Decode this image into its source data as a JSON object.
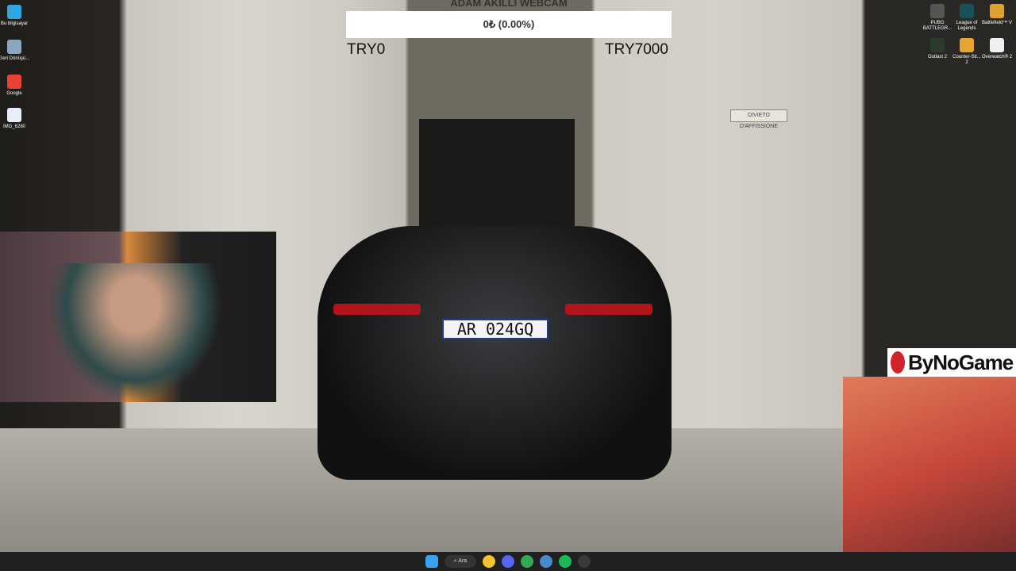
{
  "overlay": {
    "title": "ADAM AKILLI WEBCAM",
    "progress_text": "0₺ (0.00%)",
    "progress_percent": 0,
    "min_label": "TRY0",
    "max_label": "TRY7000"
  },
  "scene": {
    "plate": "AR 024GQ",
    "sign": "DIVIETO D'AFFISSIONE"
  },
  "desktop_left": [
    {
      "label": "Bu bilgisayar",
      "icon": "computer-icon",
      "color": "#2fa6e0"
    },
    {
      "label": "Geri Dönüşü...",
      "icon": "recycle-bin-icon",
      "color": "#8aa6c0"
    },
    {
      "label": "Google",
      "icon": "chrome-icon",
      "color": "#e94235"
    },
    {
      "label": "IMG_6280",
      "icon": "image-file-icon",
      "color": "#e8eef6"
    }
  ],
  "desktop_right": [
    {
      "label": "PUBG BATTLEGR...",
      "icon": "pubg-icon",
      "color": "#555"
    },
    {
      "label": "League of Legends",
      "icon": "lol-icon",
      "color": "#1a5058"
    },
    {
      "label": "Battlefield™ V",
      "icon": "battlefield-icon",
      "color": "#e0a030"
    },
    {
      "label": "Outlast 2",
      "icon": "outlast-icon",
      "color": "#2b3a2a"
    },
    {
      "label": "Counter-Str... 2",
      "icon": "cs2-icon",
      "color": "#e6a530"
    },
    {
      "label": "Overwatch® 2",
      "icon": "overwatch-icon",
      "color": "#f0f0f0"
    }
  ],
  "brand": {
    "name": "ByNoGame",
    "color": "#d2232a"
  },
  "taskbar": {
    "search_label": "Ara",
    "apps": [
      {
        "icon": "file-explorer-icon",
        "color": "#f2c230"
      },
      {
        "icon": "discord-icon",
        "color": "#5865f2"
      },
      {
        "icon": "chrome-icon",
        "color": "#34a853"
      },
      {
        "icon": "app-icon",
        "color": "#4a8ad0"
      },
      {
        "icon": "spotify-icon",
        "color": "#1db954"
      },
      {
        "icon": "obs-icon",
        "color": "#3a3a3a"
      }
    ]
  }
}
